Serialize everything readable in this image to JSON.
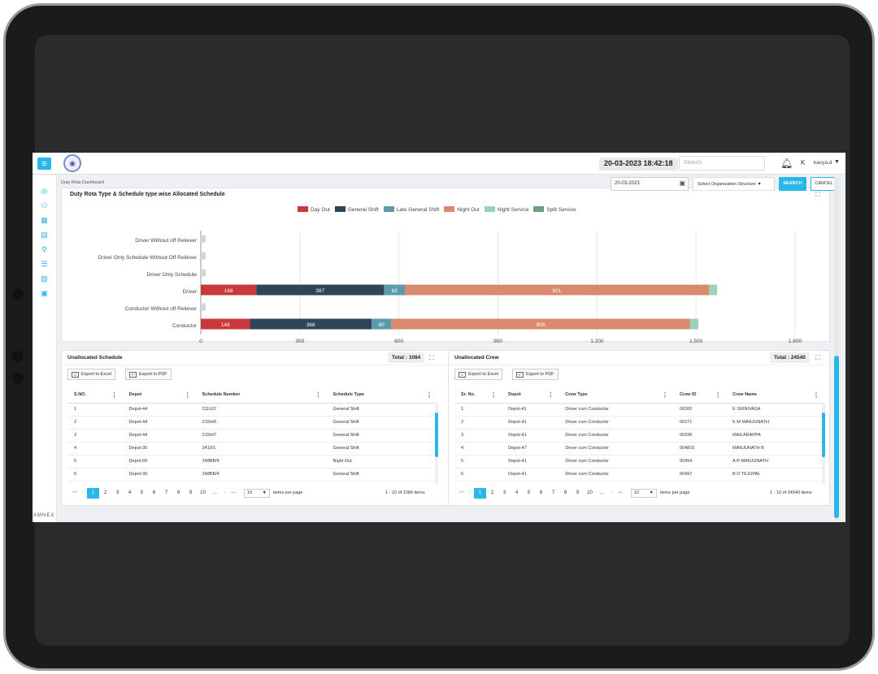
{
  "header": {
    "datetime": "20-03-2023 18:42:18",
    "search_placeholder": "Search",
    "user_initial": "K",
    "user_name": "kavya.d"
  },
  "brand": "AMNEX",
  "breadcrumb": "Duty Rota Dashboard",
  "filters": {
    "date": "20-03-2023",
    "org_select": "Select Organization Structure ▼",
    "search_label": "SEARCH",
    "cancel_label": "CANCEL"
  },
  "chart_data": {
    "type": "bar",
    "orientation": "horizontal",
    "stacked": true,
    "title": "Duty Rota Type & Schedule type wise Allocated Schedule",
    "categories": [
      "Driver Without off Reliever",
      "Driver Only Schedule Without Off Reliever",
      "Driver Only Schedule",
      "Driver",
      "Conductor Without off Reliever",
      "Conductor"
    ],
    "series": [
      {
        "name": "Day Out",
        "color": "#c9383a",
        "values": [
          0,
          0,
          0,
          168,
          0,
          149
        ]
      },
      {
        "name": "General Shift",
        "color": "#2e4457",
        "values": [
          0,
          0,
          0,
          387,
          0,
          368
        ]
      },
      {
        "name": "Late General Shift",
        "color": "#5b9aa8",
        "values": [
          0,
          0,
          0,
          63,
          0,
          60
        ]
      },
      {
        "name": "Night Out",
        "color": "#d98a6c",
        "values": [
          0,
          0,
          0,
          921,
          0,
          905
        ]
      },
      {
        "name": "Night Service",
        "color": "#9ed1bd",
        "values": [
          0,
          0,
          0,
          25,
          0,
          25
        ]
      },
      {
        "name": "Split Service",
        "color": "#6a9f80",
        "values": [
          0,
          0,
          0,
          0,
          0,
          0
        ]
      }
    ],
    "x_ticks": [
      "0",
      "300",
      "600",
      "900",
      "1,200",
      "1,500",
      "1,800"
    ],
    "xlim": [
      0,
      1800
    ],
    "grid": true,
    "legend": "top"
  },
  "unallocated_schedule": {
    "title": "Unallocated Schedule",
    "total": "Total : 1084",
    "export_excel": "Export to Excel",
    "export_pdf": "Export to PDF",
    "columns": [
      "S.NO.",
      "Depot",
      "Schedule Number",
      "Schedule Type"
    ],
    "rows": [
      [
        "1",
        "Depot-44",
        "211U/2",
        "General Shift"
      ],
      [
        "2",
        "Depot-44",
        "215H/6",
        "General Shift"
      ],
      [
        "3",
        "Depot-44",
        "215H/7",
        "General Shift"
      ],
      [
        "4",
        "Depot-35",
        "2410/1",
        "General Shift"
      ],
      [
        "5",
        "Depot-09",
        "248BB/4",
        "Night Out"
      ],
      [
        "6",
        "Depot-30",
        "248BB/4",
        "General Shift"
      ]
    ],
    "pages": [
      "1",
      "2",
      "3",
      "4",
      "5",
      "6",
      "7",
      "8",
      "9",
      "10",
      "..."
    ],
    "per_page": "10",
    "per_page_label": "items per page",
    "info": "1 - 10 of 1084 items"
  },
  "unallocated_crew": {
    "title": "Unallocated Crew",
    "total": "Total : 24540",
    "export_excel": "Export to Excel",
    "export_pdf": "Export to PDF",
    "columns": [
      "Sr. No.",
      "Depot",
      "Crew Type",
      "Crew ID",
      "Crew Name"
    ],
    "rows": [
      [
        "1",
        "Depot-41",
        "Driver cum Conductor",
        "00260",
        "E SRINIVASA"
      ],
      [
        "2",
        "Depot-41",
        "Driver cum Conductor",
        "00271",
        "K M MANJUNATH"
      ],
      [
        "3",
        "Depot-41",
        "Driver cum Conductor",
        "00336",
        "MAILARAPPA"
      ],
      [
        "4",
        "Depot-47",
        "Driver cum Conductor",
        "004816",
        "MANJUNATH B"
      ],
      [
        "5",
        "Depot-41",
        "Driver cum Conductor",
        "00494",
        "A R MANJUNATH"
      ],
      [
        "6",
        "Depot-41",
        "Driver cum Conductor",
        "00497",
        "B D TEJUPAL"
      ]
    ],
    "pages": [
      "1",
      "2",
      "3",
      "4",
      "5",
      "6",
      "7",
      "8",
      "9",
      "10",
      "..."
    ],
    "per_page": "10",
    "per_page_label": "items per page",
    "info": "1 - 10 of 24540 items"
  }
}
